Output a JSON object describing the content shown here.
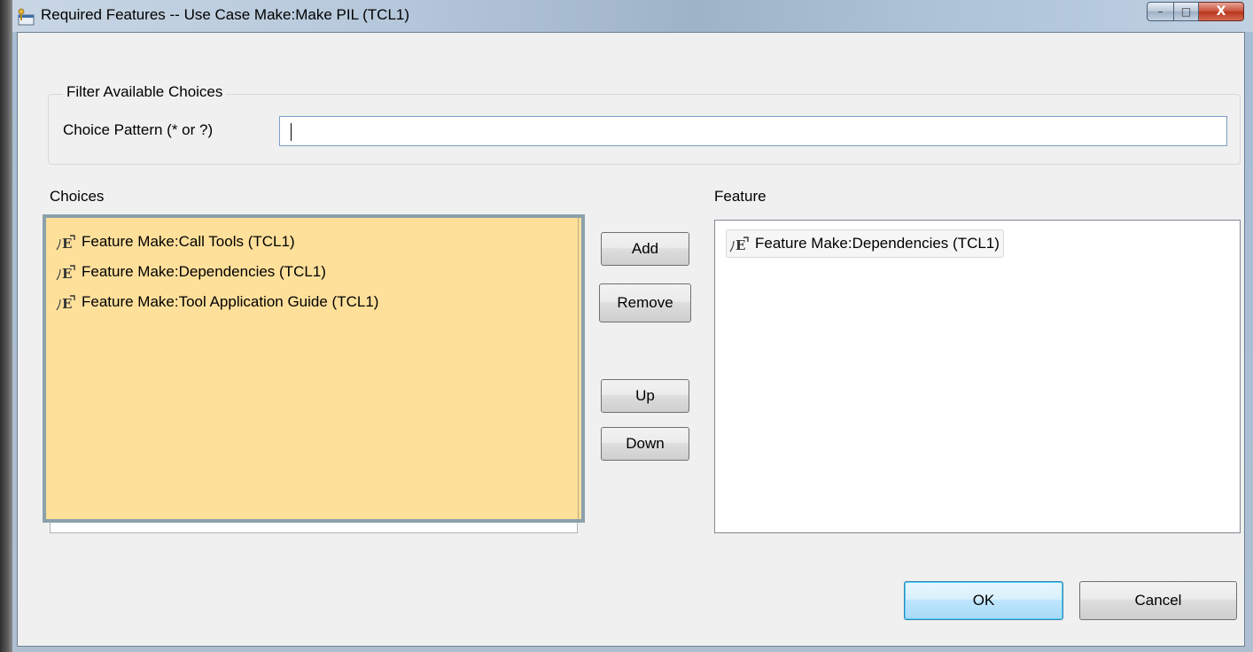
{
  "window": {
    "title": "Required Features -- Use Case Make:Make PIL (TCL1)",
    "controls": {
      "minimize": "–",
      "maximize": "□",
      "close": "X"
    }
  },
  "filter": {
    "group_title": "Filter Available Choices",
    "pattern_label": "Choice Pattern (* or ?)",
    "pattern_value": ""
  },
  "choices": {
    "label": "Choices",
    "items": [
      {
        "label": "Feature Make:Call Tools (TCL1)",
        "icon": "feature-icon"
      },
      {
        "label": "Feature Make:Dependencies (TCL1)",
        "icon": "feature-icon"
      },
      {
        "label": "Feature Make:Tool Application Guide (TCL1)",
        "icon": "feature-icon"
      }
    ]
  },
  "feature": {
    "label": "Feature",
    "items": [
      {
        "label": "Feature Make:Dependencies (TCL1)",
        "icon": "feature-icon"
      }
    ]
  },
  "actions": {
    "add": "Add",
    "remove": "Remove",
    "up": "Up",
    "down": "Down"
  },
  "footer": {
    "ok": "OK",
    "cancel": "Cancel"
  },
  "colors": {
    "choices_background": "#ffe09b",
    "choices_border": "#8ba1ab",
    "default_button_border": "#3c7fb1"
  }
}
